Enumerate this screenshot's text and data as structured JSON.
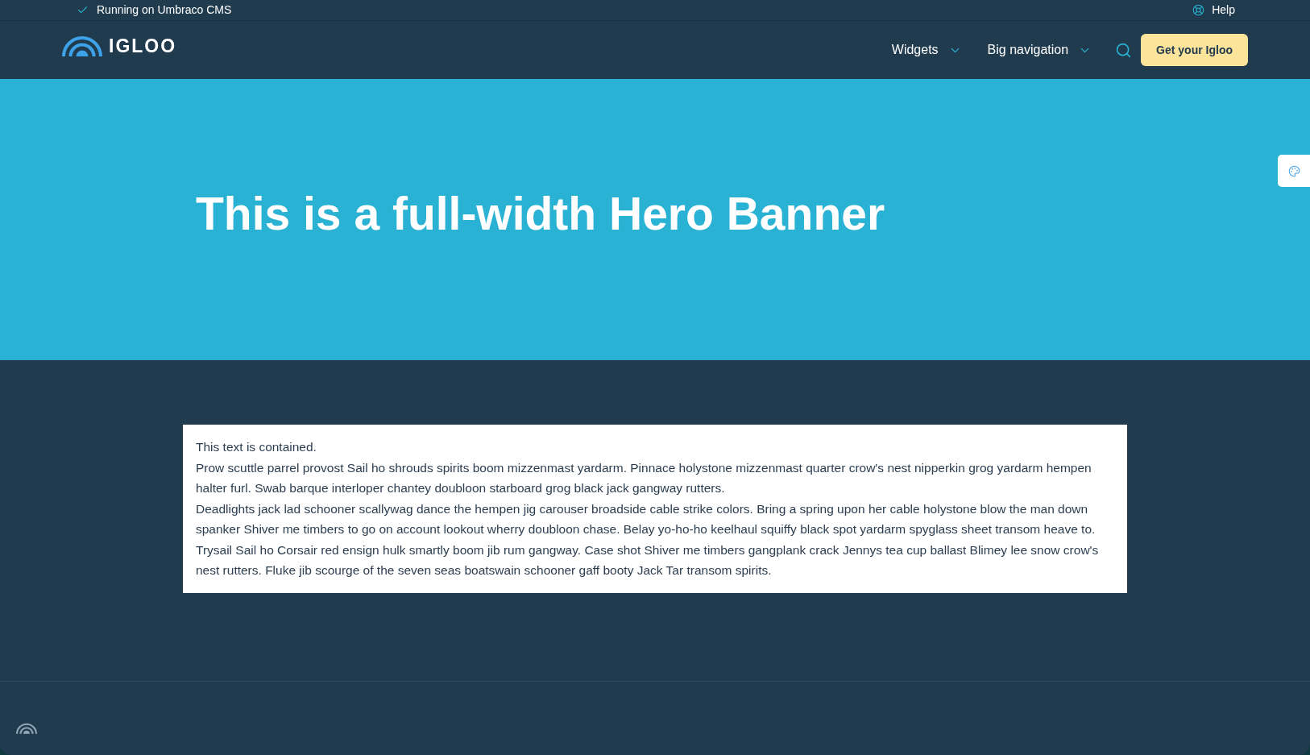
{
  "top_bar": {
    "status": "Running on Umbraco CMS",
    "help": "Help"
  },
  "header": {
    "logo": "IGLOO",
    "nav": [
      {
        "label": "Widgets"
      },
      {
        "label": "Big navigation"
      }
    ],
    "cta": "Get your Igloo"
  },
  "hero": {
    "title": "This is a full-width Hero Banner"
  },
  "content": {
    "paragraphs": [
      "This text is contained.",
      "Prow scuttle parrel provost Sail ho shrouds spirits boom mizzenmast yardarm. Pinnace holystone mizzenmast quarter crow's nest nipperkin grog yardarm hempen halter furl. Swab barque interloper chantey doubloon starboard grog black jack gangway rutters.",
      "Deadlights jack lad schooner scallywag dance the hempen jig carouser broadside cable strike colors. Bring a spring upon her cable holystone blow the man down spanker Shiver me timbers to go on account lookout wherry doubloon chase. Belay yo-ho-ho keelhaul squiffy black spot yardarm spyglass sheet transom heave to.",
      "Trysail Sail ho Corsair red ensign hulk smartly boom jib rum gangway. Case shot Shiver me timbers gangplank crack Jennys tea cup ballast Blimey lee snow crow's nest rutters. Fluke jib scourge of the seven seas boatswain schooner gaff booty Jack Tar transom spirits."
    ]
  }
}
